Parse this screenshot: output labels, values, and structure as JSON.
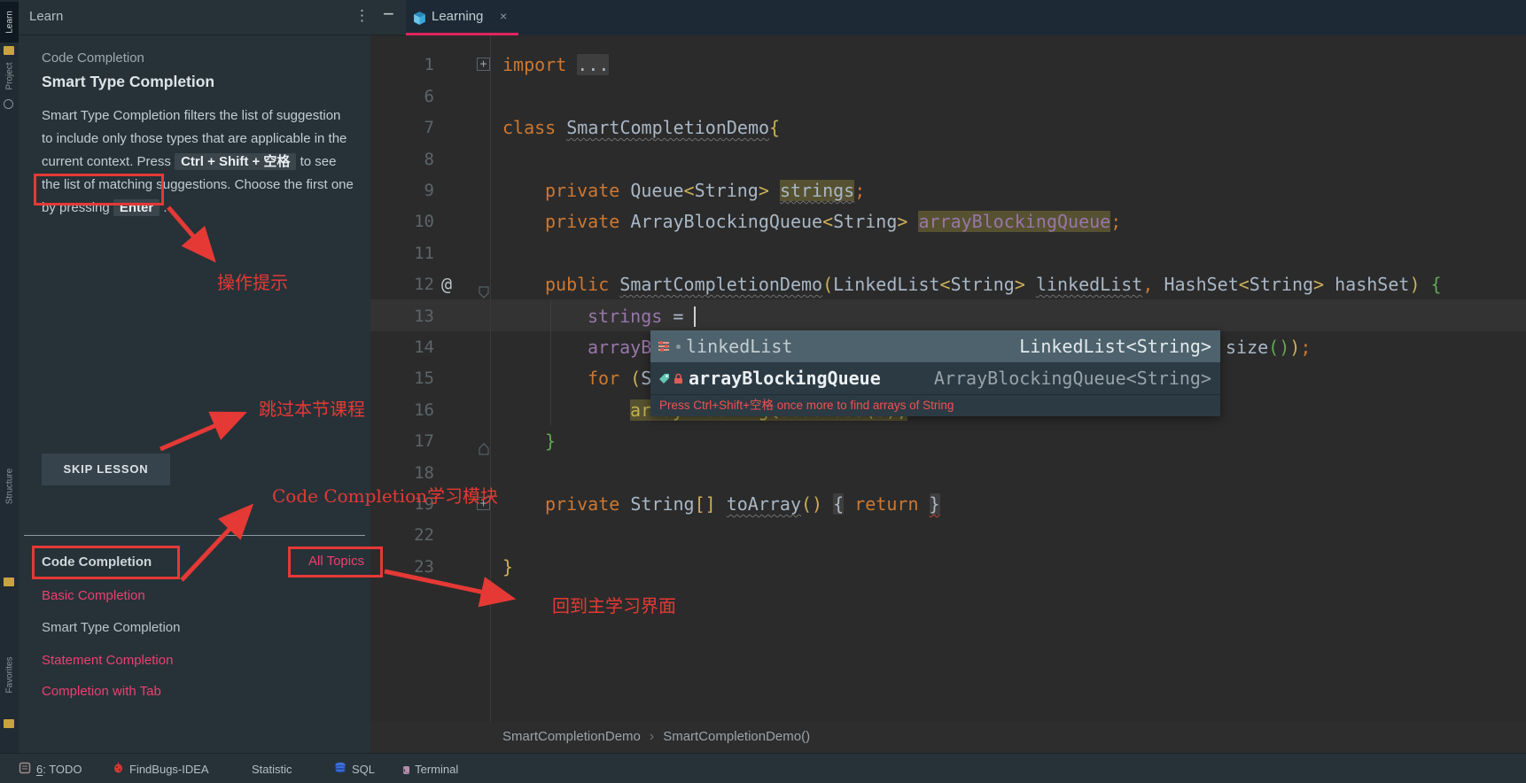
{
  "stripe": {
    "top_items": [
      {
        "label": "Learn",
        "active": true
      },
      {
        "label": "Project",
        "active": false
      }
    ],
    "bottom_items": [
      {
        "label": "Structure"
      },
      {
        "label": "Favorites"
      }
    ]
  },
  "learn": {
    "panel_title": "Learn",
    "kebab_icon": "⋮",
    "hide_icon": "−",
    "category": "Code Completion",
    "title": "Smart Type Completion",
    "paragraph": [
      {
        "text": "Smart Type Completion filters the list of suggestion to include only those types that are applicable in the current context. Press "
      },
      {
        "text": "Ctrl + Shift + 空格",
        "chip": true
      },
      {
        "text": " to see the list of matching suggestions. Choose the first one by pressing "
      },
      {
        "text": "Enter",
        "chip": true
      },
      {
        "text": " ."
      }
    ],
    "skip_button": "SKIP LESSON",
    "modules": [
      {
        "label": "Code Completion",
        "style": "header"
      },
      {
        "label": "Basic Completion",
        "style": "link"
      },
      {
        "label": "Smart Type Completion",
        "style": "current"
      },
      {
        "label": "Statement Completion",
        "style": "link"
      },
      {
        "label": "Completion with Tab",
        "style": "link"
      }
    ],
    "all_topics": "All Topics"
  },
  "tab": {
    "label": "Learning",
    "close_icon": "×"
  },
  "editor": {
    "lines": [
      {
        "n": "1",
        "fold": "plus",
        "ind": 0,
        "segs": [
          {
            "t": "import",
            "c": "kw"
          },
          {
            "t": " ",
            "c": "pl"
          },
          {
            "t": "...",
            "c": "pl",
            "box": 1
          }
        ]
      },
      {
        "n": "6",
        "segs": []
      },
      {
        "n": "7",
        "ind": 0,
        "segs": [
          {
            "t": "class ",
            "c": "kw"
          },
          {
            "t": "SmartCompletionDemo",
            "c": "pl",
            "u": 1
          },
          {
            "t": "{",
            "c": "yel"
          }
        ]
      },
      {
        "n": "8",
        "segs": []
      },
      {
        "n": "9",
        "ind": 4,
        "segs": [
          {
            "t": "private ",
            "c": "kw"
          },
          {
            "t": "Queue",
            "c": "pl"
          },
          {
            "t": "<",
            "c": "yel"
          },
          {
            "t": "String",
            "c": "pl"
          },
          {
            "t": ">",
            "c": "yel"
          },
          {
            "t": " ",
            "c": "pl"
          },
          {
            "t": "strings",
            "c": "pl",
            "u": 1,
            "hl": 1
          },
          {
            "t": ";",
            "c": "kw"
          }
        ]
      },
      {
        "n": "10",
        "ind": 4,
        "segs": [
          {
            "t": "private ",
            "c": "kw"
          },
          {
            "t": "ArrayBlockingQueue",
            "c": "pl"
          },
          {
            "t": "<",
            "c": "yel"
          },
          {
            "t": "String",
            "c": "pl"
          },
          {
            "t": ">",
            "c": "yel"
          },
          {
            "t": " ",
            "c": "pl"
          },
          {
            "t": "arrayBlockingQueue",
            "c": "fld",
            "hl": 1
          },
          {
            "t": ";",
            "c": "kw"
          }
        ]
      },
      {
        "n": "11",
        "segs": []
      },
      {
        "n": "12",
        "at": 1,
        "fold": "open",
        "ind": 4,
        "segs": [
          {
            "t": "public ",
            "c": "kw"
          },
          {
            "t": "SmartCompletionDemo",
            "c": "pl",
            "u": 1
          },
          {
            "t": "(",
            "c": "yel"
          },
          {
            "t": "LinkedList",
            "c": "pl"
          },
          {
            "t": "<",
            "c": "yel"
          },
          {
            "t": "String",
            "c": "pl"
          },
          {
            "t": ">",
            "c": "yel"
          },
          {
            "t": " ",
            "c": "pl"
          },
          {
            "t": "linkedList",
            "c": "pl",
            "u": 1
          },
          {
            "t": ", ",
            "c": "kw"
          },
          {
            "t": "HashSet",
            "c": "pl"
          },
          {
            "t": "<",
            "c": "yel"
          },
          {
            "t": "String",
            "c": "pl"
          },
          {
            "t": ">",
            "c": "yel"
          },
          {
            "t": " ",
            "c": "pl"
          },
          {
            "t": "hashSet",
            "c": "pl"
          },
          {
            "t": ") ",
            "c": "yel"
          },
          {
            "t": "{",
            "c": "grn"
          }
        ]
      },
      {
        "n": "13",
        "cur": 1,
        "caret": 1,
        "ind": 8,
        "segs": [
          {
            "t": "strings",
            "c": "fld"
          },
          {
            "t": " = ",
            "c": "pl"
          }
        ]
      },
      {
        "n": "14",
        "ind": 8,
        "segs": [
          {
            "t": "arrayB",
            "c": "fld"
          }
        ]
      },
      {
        "n": "15",
        "ind": 8,
        "segs": [
          {
            "t": "for ",
            "c": "kw"
          },
          {
            "t": "(",
            "c": "yel"
          },
          {
            "t": "S",
            "c": "pl"
          }
        ]
      },
      {
        "n": "16",
        "ind": 12,
        "segs": [
          {
            "t": "arrayBlockingQueue.add(s);",
            "c": "olv",
            "hl": 1
          }
        ]
      },
      {
        "n": "17",
        "fold": "close",
        "ind": 4,
        "segs": [
          {
            "t": "}",
            "c": "grn"
          }
        ]
      },
      {
        "n": "18",
        "segs": []
      },
      {
        "n": "19",
        "fold": "plus",
        "ind": 4,
        "segs": [
          {
            "t": "private ",
            "c": "kw"
          },
          {
            "t": "String",
            "c": "pl"
          },
          {
            "t": "[]",
            "c": "yel"
          },
          {
            "t": " ",
            "c": "pl"
          },
          {
            "t": "toArray",
            "c": "pl",
            "u": 1
          },
          {
            "t": "()",
            "c": "yel"
          },
          {
            "t": " ",
            "c": "pl"
          },
          {
            "t": "{",
            "c": "pl",
            "box": 1
          },
          {
            "t": " ",
            "c": "pl"
          },
          {
            "t": "return ",
            "c": "kw"
          },
          {
            "t": "}",
            "c": "pl",
            "box": 1,
            "ur": 1
          }
        ]
      },
      {
        "n": "22",
        "segs": []
      },
      {
        "n": "23",
        "ind": 0,
        "segs": [
          {
            "t": "}",
            "c": "yel"
          }
        ]
      }
    ],
    "gutter_annotation": "@",
    "line14_tail": [
      {
        "t": "size",
        "c": "pl"
      },
      {
        "t": "()",
        "c": "grn"
      },
      {
        "t": ")",
        "c": "yel"
      },
      {
        "t": ";",
        "c": "kw"
      }
    ],
    "completion": {
      "items": [
        {
          "name": "linkedList",
          "type": "LinkedList<String>",
          "icon": "parameter",
          "dot": true,
          "selected": true,
          "bold": false
        },
        {
          "name": "arrayBlockingQueue",
          "type": "ArrayBlockingQueue<String>",
          "icon": "field-lock",
          "dot": false,
          "selected": false,
          "bold": true
        }
      ],
      "hint": "Press Ctrl+Shift+空格 once more to find arrays of String"
    },
    "breadcrumbs": [
      "SmartCompletionDemo",
      "SmartCompletionDemo()"
    ]
  },
  "annotations": {
    "tip_action": "操作提示",
    "tip_skip": "跳过本节课程",
    "tip_module": "Code Completion学习模块",
    "tip_back": "回到主学习界面"
  },
  "statusbar": {
    "items": [
      {
        "icon": "todo",
        "pre": "6",
        "label": ": TODO"
      },
      {
        "icon": "bug",
        "pre": "",
        "label": "FindBugs-IDEA"
      },
      {
        "icon": "pie",
        "pre": "",
        "label": "Statistic"
      },
      {
        "icon": "database",
        "pre": "",
        "label": "SQL"
      },
      {
        "icon": "terminal",
        "pre": "",
        "label": "Terminal"
      }
    ]
  },
  "colors": {
    "panel_bg": "#263238",
    "editor_bg": "#2b2b2b",
    "tabbar_bg": "#1d2a35",
    "accent_pink": "#e0255f",
    "link_pink": "#ee3f70",
    "annotation_red": "#e53935",
    "keyword_orange": "#cc7832",
    "plain_code": "#a9b7c6",
    "field_purple": "#9876aa",
    "occurrence_bg": "#565130",
    "popup_selected_bg": "#4d626c",
    "popup_bg": "#2c3a44",
    "hint_red": "#f25050"
  }
}
